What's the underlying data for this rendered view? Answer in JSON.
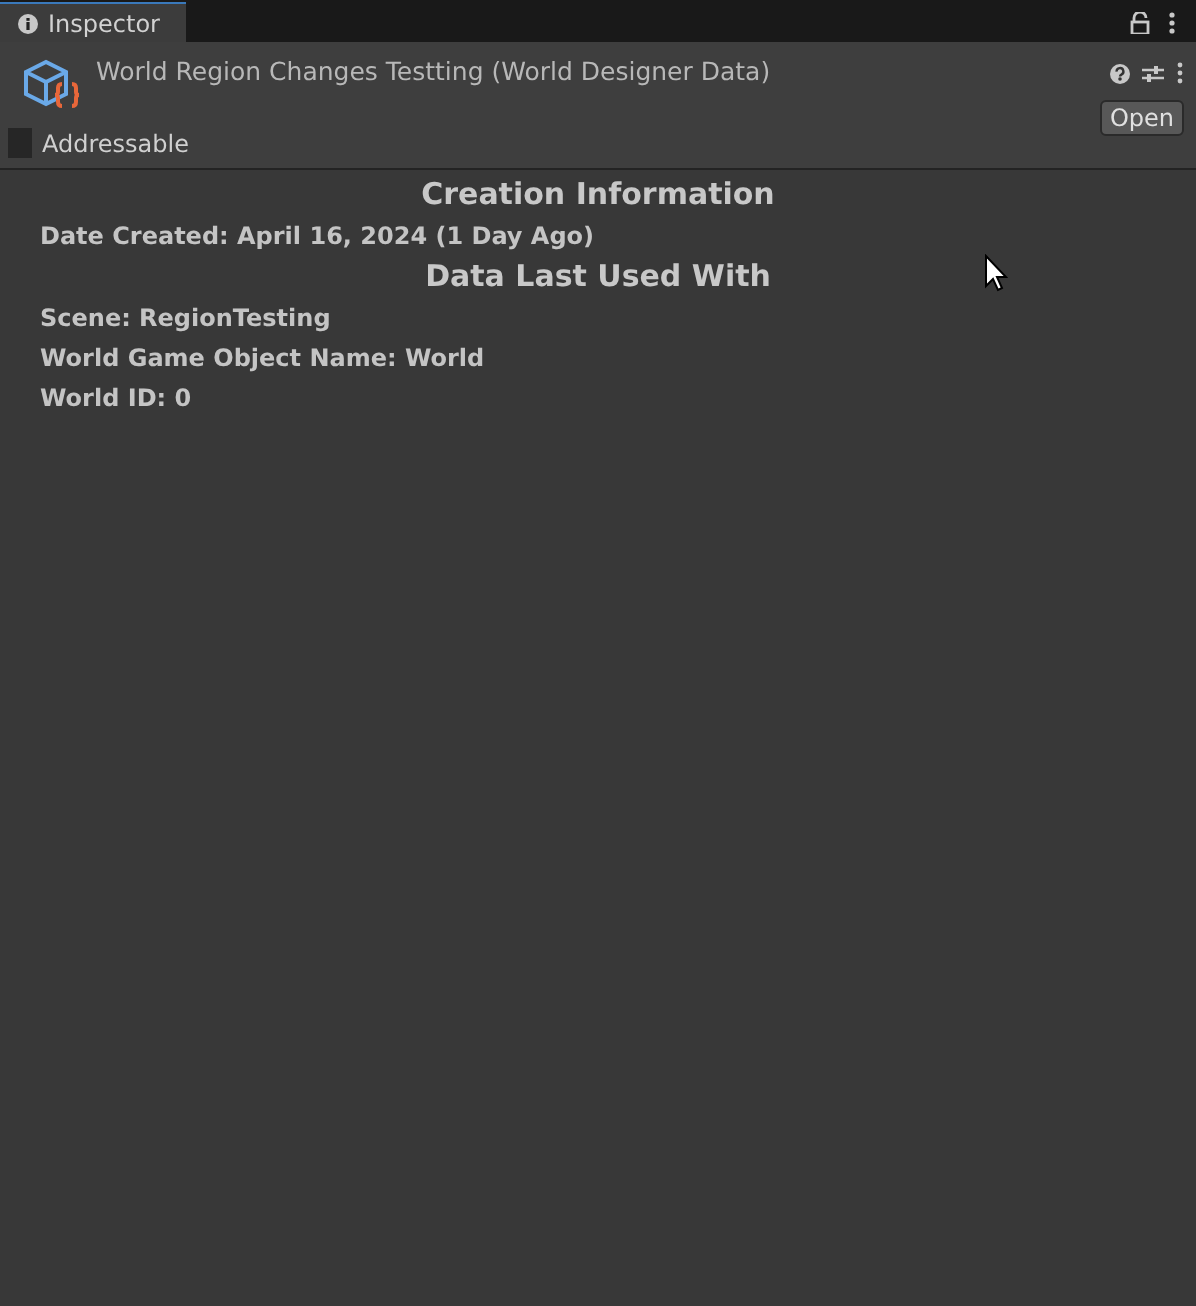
{
  "tab": {
    "label": "Inspector",
    "selected": true
  },
  "header": {
    "title": "World Region Changes Testting (World Designer Data)",
    "open_button": "Open",
    "addressable": {
      "label": "Addressable",
      "checked": false
    }
  },
  "sections": [
    {
      "heading": "Creation Information",
      "lines": [
        "Date Created: April 16, 2024 (1 Day Ago)"
      ]
    },
    {
      "heading": "Data Last Used With",
      "lines": [
        "Scene: RegionTesting",
        "World Game Object Name: World",
        "World ID: 0"
      ]
    }
  ]
}
